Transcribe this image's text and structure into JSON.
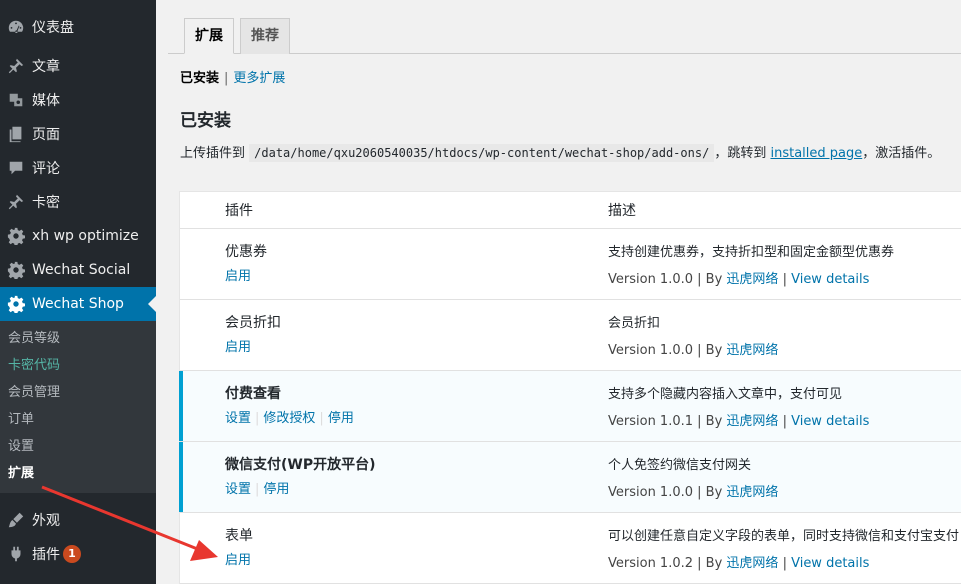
{
  "sidebar": {
    "top_items": [
      {
        "label": "仪表盘",
        "icon": "dashboard-icon"
      },
      {
        "label": "文章",
        "icon": "pushpin-icon"
      },
      {
        "label": "媒体",
        "icon": "media-icon"
      },
      {
        "label": "页面",
        "icon": "page-icon"
      },
      {
        "label": "评论",
        "icon": "comment-icon"
      },
      {
        "label": "卡密",
        "icon": "pushpin-icon"
      },
      {
        "label": "xh wp optimize",
        "icon": "gear-icon"
      },
      {
        "label": "Wechat Social",
        "icon": "gear-icon"
      },
      {
        "label": "Wechat Shop",
        "icon": "gear-icon"
      }
    ],
    "submenu": [
      "会员等级",
      "卡密代码",
      "会员管理",
      "订单",
      "设置",
      "扩展"
    ],
    "bottom_items": [
      {
        "label": "外观",
        "icon": "brush-icon"
      },
      {
        "label": "插件",
        "icon": "plugin-icon",
        "badge": "1"
      }
    ],
    "active_color": "#0073aa"
  },
  "tabs": [
    "扩展",
    "推荐"
  ],
  "filter": {
    "current": "已安装",
    "sep": "|",
    "more": "更多扩展"
  },
  "heading": "已安装",
  "upload": {
    "prefix": "上传插件到",
    "path": "/data/home/qxu2060540035/htdocs/wp-content/wechat-shop/add-ons/",
    "middle": "，跳转到",
    "link": "installed page",
    "suffix": "，激活插件。"
  },
  "table": {
    "headers": [
      "插件",
      "描述"
    ],
    "rows": [
      {
        "name": "优惠券",
        "actions": [
          "启用"
        ],
        "desc": "支持创建优惠券，支持折扣型和固定金额型优惠券",
        "version": "Version 1.0.0",
        "by": "| By",
        "author": "迅虎网络",
        "details": "View details",
        "active": false
      },
      {
        "name": "会员折扣",
        "actions": [
          "启用"
        ],
        "desc": "会员折扣",
        "version": "Version 1.0.0",
        "by": "| By",
        "author": "迅虎网络",
        "details": "",
        "active": false
      },
      {
        "name": "付费查看",
        "actions": [
          "设置",
          "修改授权",
          "停用"
        ],
        "desc": "支持多个隐藏内容插入文章中，支付可见",
        "version": "Version 1.0.1",
        "by": "| By",
        "author": "迅虎网络",
        "details": "View details",
        "active": true
      },
      {
        "name": "微信支付(WP开放平台)",
        "actions": [
          "设置",
          "停用"
        ],
        "desc": "个人免签约微信支付网关",
        "version": "Version 1.0.0",
        "by": "| By",
        "author": "迅虎网络",
        "details": "",
        "active": true
      },
      {
        "name": "表单",
        "actions": [
          "启用"
        ],
        "desc": "可以创建任意自定义字段的表单，同时支持微信和支付宝支付",
        "version": "Version 1.0.2",
        "by": "| By",
        "author": "迅虎网络",
        "details": "View details",
        "active": false
      }
    ]
  }
}
